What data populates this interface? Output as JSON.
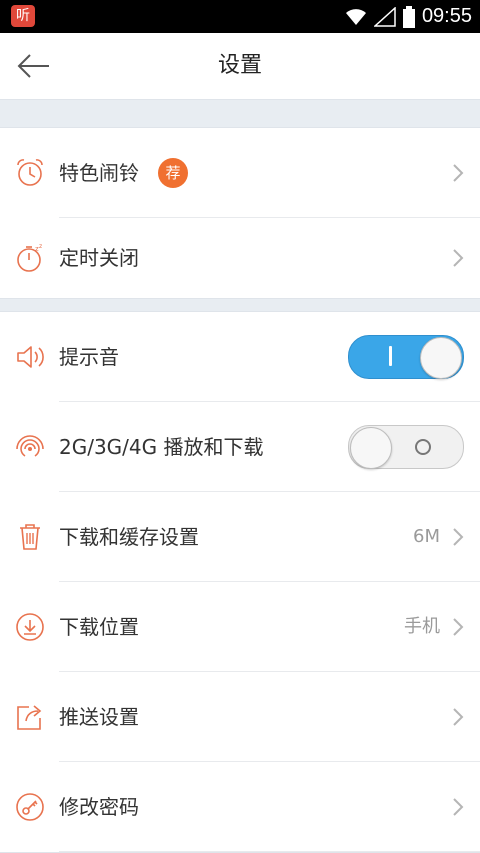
{
  "status_bar": {
    "app_icon_text": "听",
    "time": "09:55",
    "icons": [
      "wifi-icon",
      "signal-icon",
      "battery-icon"
    ]
  },
  "header": {
    "title": "设置",
    "back_icon": "back-arrow-icon"
  },
  "section1": {
    "items": [
      {
        "label": "特色闹铃",
        "badge": "荐",
        "icon": "alarm-clock-icon"
      },
      {
        "label": "定时关闭",
        "icon": "sleep-timer-icon"
      }
    ]
  },
  "section2": {
    "items": [
      {
        "label": "提示音",
        "icon": "speaker-icon",
        "toggle": "on"
      },
      {
        "label": "2G/3G/4G 播放和下载",
        "icon": "signal-waves-icon",
        "toggle": "off"
      },
      {
        "label": "下载和缓存设置",
        "icon": "trash-icon",
        "value": "6M"
      },
      {
        "label": "下载位置",
        "icon": "download-icon",
        "value": "手机"
      },
      {
        "label": "推送设置",
        "icon": "push-share-icon"
      },
      {
        "label": "修改密码",
        "icon": "key-icon"
      }
    ]
  },
  "colors": {
    "accent": "#e8734f",
    "toggle_on": "#3aa6e8",
    "badge": "#f07030",
    "chevron": "#b5b5b5"
  }
}
